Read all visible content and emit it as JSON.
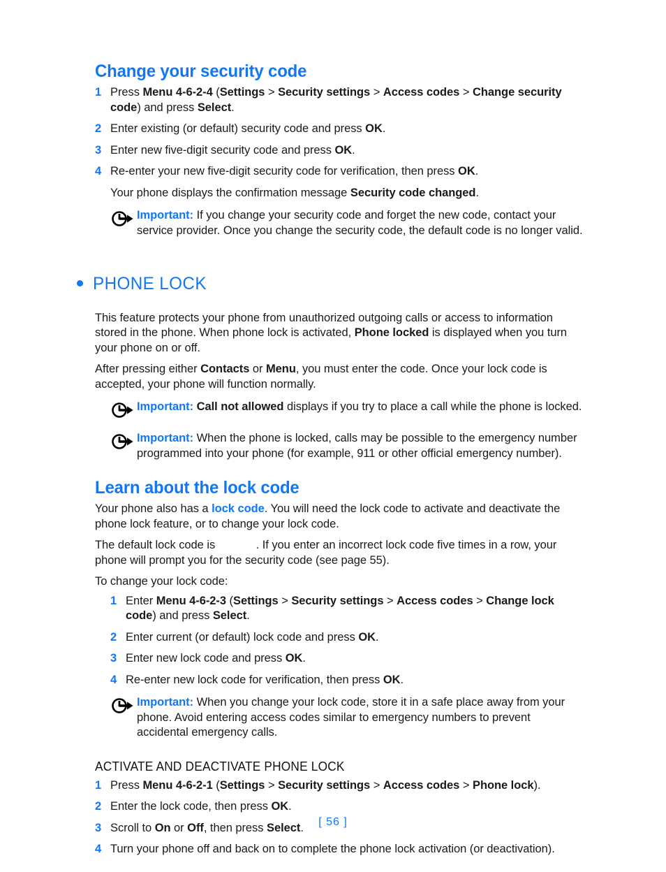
{
  "page": {
    "number_label": "[ 56 ]",
    "accent_color": "#1277f2",
    "text_color": "#1a1a1a",
    "background": "#ffffff"
  },
  "sections": {
    "change_security_code": {
      "heading": "Change your security code",
      "steps": [
        {
          "num": "1",
          "parts": [
            {
              "t": "Press ",
              "style": "normal"
            },
            {
              "t": "Menu 4-6-2-4",
              "style": "bold"
            },
            {
              "t": " (",
              "style": "normal"
            },
            {
              "t": "Settings",
              "style": "bold"
            },
            {
              "t": " > ",
              "style": "normal"
            },
            {
              "t": "Security settings",
              "style": "bold"
            },
            {
              "t": " > ",
              "style": "normal"
            },
            {
              "t": "Access codes",
              "style": "bold"
            },
            {
              "t": " > ",
              "style": "normal"
            },
            {
              "t": "Change security code",
              "style": "bold"
            },
            {
              "t": ") and press ",
              "style": "normal"
            },
            {
              "t": "Select",
              "style": "bold"
            },
            {
              "t": ".",
              "style": "normal"
            }
          ]
        },
        {
          "num": "2",
          "parts": [
            {
              "t": "Enter existing (or default) security code and press ",
              "style": "normal"
            },
            {
              "t": "OK",
              "style": "bold"
            },
            {
              "t": ".",
              "style": "normal"
            }
          ]
        },
        {
          "num": "3",
          "parts": [
            {
              "t": "Enter new five-digit security code and press ",
              "style": "normal"
            },
            {
              "t": "OK",
              "style": "bold"
            },
            {
              "t": ".",
              "style": "normal"
            }
          ]
        },
        {
          "num": "4",
          "parts": [
            {
              "t": "Re-enter your new five-digit security code for verification, then press ",
              "style": "normal"
            },
            {
              "t": "OK",
              "style": "bold"
            },
            {
              "t": ".",
              "style": "normal"
            }
          ]
        }
      ],
      "confirmation": [
        {
          "t": "Your phone displays the confirmation message ",
          "style": "normal"
        },
        {
          "t": "Security code changed",
          "style": "bold"
        },
        {
          "t": ".",
          "style": "normal"
        }
      ],
      "note": {
        "icon": "note-arrow-circle-icon",
        "label": "Important:",
        "parts": [
          {
            "t": " If you change your security code and forget the new code, contact your service provider. Once you change the security code, the default code is no longer valid.",
            "style": "normal"
          }
        ]
      }
    },
    "phone_lock": {
      "heading": "PHONE LOCK",
      "bullet": "•",
      "paragraphs": [
        [
          {
            "t": "This feature protects your phone from unauthorized outgoing calls or access to information stored in the phone. When phone lock is activated, ",
            "style": "normal"
          },
          {
            "t": "Phone locked",
            "style": "bold"
          },
          {
            "t": " is displayed when you turn your phone on or off.",
            "style": "normal"
          }
        ],
        [
          {
            "t": "After pressing either ",
            "style": "normal"
          },
          {
            "t": "Contacts",
            "style": "bold"
          },
          {
            "t": " or ",
            "style": "normal"
          },
          {
            "t": "Menu",
            "style": "bold"
          },
          {
            "t": ", you must enter the code. Once your lock code is accepted, your phone will function normally.",
            "style": "normal"
          }
        ]
      ],
      "notes": [
        {
          "icon": "note-arrow-circle-icon",
          "label": "Important:",
          "parts": [
            {
              "t": " ",
              "style": "normal"
            },
            {
              "t": "Call not allowed",
              "style": "bold"
            },
            {
              "t": " displays if you try to place a call while the phone is locked.",
              "style": "normal"
            }
          ]
        },
        {
          "icon": "note-arrow-circle-icon",
          "label": "Important:",
          "parts": [
            {
              "t": " When the phone is locked, calls may be possible to the emergency number programmed into your phone (for example, 911 or other official emergency number).",
              "style": "normal"
            }
          ]
        }
      ]
    },
    "learn_lock_code": {
      "heading": "Learn about the lock code",
      "paragraphs": [
        [
          {
            "t": "Your phone also has a ",
            "style": "normal"
          },
          {
            "t": "lock code",
            "style": "blue-bold"
          },
          {
            "t": ". You will need the lock code to activate and deactivate the phone lock feature, or to change your lock code.",
            "style": "normal"
          }
        ],
        [
          {
            "t": "The default lock code is ",
            "style": "normal"
          },
          {
            "t": "",
            "style": "blank"
          },
          {
            "t": ". If you enter an incorrect lock code five times in a row, your phone will prompt you for the security code (see page 55).",
            "style": "normal"
          }
        ],
        [
          {
            "t": "To change your lock code:",
            "style": "normal"
          }
        ]
      ],
      "steps": [
        {
          "num": "1",
          "parts": [
            {
              "t": "Enter ",
              "style": "normal"
            },
            {
              "t": "Menu 4-6-2-3",
              "style": "bold"
            },
            {
              "t": " (",
              "style": "normal"
            },
            {
              "t": "Settings",
              "style": "bold"
            },
            {
              "t": " > ",
              "style": "normal"
            },
            {
              "t": "Security settings",
              "style": "bold"
            },
            {
              "t": " > ",
              "style": "normal"
            },
            {
              "t": "Access codes",
              "style": "bold"
            },
            {
              "t": " > ",
              "style": "normal"
            },
            {
              "t": "Change lock code",
              "style": "bold"
            },
            {
              "t": ") and press ",
              "style": "normal"
            },
            {
              "t": "Select",
              "style": "bold"
            },
            {
              "t": ".",
              "style": "normal"
            }
          ]
        },
        {
          "num": "2",
          "parts": [
            {
              "t": "Enter current (or default) lock code and press ",
              "style": "normal"
            },
            {
              "t": "OK",
              "style": "bold"
            },
            {
              "t": ".",
              "style": "normal"
            }
          ]
        },
        {
          "num": "3",
          "parts": [
            {
              "t": "Enter new lock code and press ",
              "style": "normal"
            },
            {
              "t": "OK",
              "style": "bold"
            },
            {
              "t": ".",
              "style": "normal"
            }
          ]
        },
        {
          "num": "4",
          "parts": [
            {
              "t": "Re-enter new lock code for verification, then press ",
              "style": "normal"
            },
            {
              "t": "OK",
              "style": "bold"
            },
            {
              "t": ".",
              "style": "normal"
            }
          ]
        }
      ],
      "note": {
        "icon": "note-arrow-circle-icon",
        "label": "Important:",
        "parts": [
          {
            "t": " When you change your lock code, store it in a safe place away from your phone. Avoid entering access codes similar to emergency numbers to prevent accidental emergency calls.",
            "style": "normal"
          }
        ]
      }
    },
    "activate_deactivate": {
      "heading": "ACTIVATE AND DEACTIVATE PHONE LOCK",
      "steps": [
        {
          "num": "1",
          "parts": [
            {
              "t": "Press ",
              "style": "normal"
            },
            {
              "t": "Menu 4-6-2-1",
              "style": "bold"
            },
            {
              "t": " (",
              "style": "normal"
            },
            {
              "t": "Settings",
              "style": "bold"
            },
            {
              "t": " > ",
              "style": "normal"
            },
            {
              "t": "Security settings",
              "style": "bold"
            },
            {
              "t": " > ",
              "style": "normal"
            },
            {
              "t": "Access codes",
              "style": "bold"
            },
            {
              "t": " > ",
              "style": "normal"
            },
            {
              "t": "Phone lock",
              "style": "bold"
            },
            {
              "t": ").",
              "style": "normal"
            }
          ]
        },
        {
          "num": "2",
          "parts": [
            {
              "t": "Enter the lock code, then press ",
              "style": "normal"
            },
            {
              "t": "OK",
              "style": "bold"
            },
            {
              "t": ".",
              "style": "normal"
            }
          ]
        },
        {
          "num": "3",
          "parts": [
            {
              "t": "Scroll to ",
              "style": "normal"
            },
            {
              "t": "On",
              "style": "bold"
            },
            {
              "t": " or ",
              "style": "normal"
            },
            {
              "t": "Off",
              "style": "bold"
            },
            {
              "t": ", then press ",
              "style": "normal"
            },
            {
              "t": "Select",
              "style": "bold"
            },
            {
              "t": ".",
              "style": "normal"
            }
          ]
        },
        {
          "num": "4",
          "parts": [
            {
              "t": "Turn your phone off and back on to complete the phone lock activation (or deactivation).",
              "style": "normal"
            }
          ]
        }
      ]
    }
  }
}
